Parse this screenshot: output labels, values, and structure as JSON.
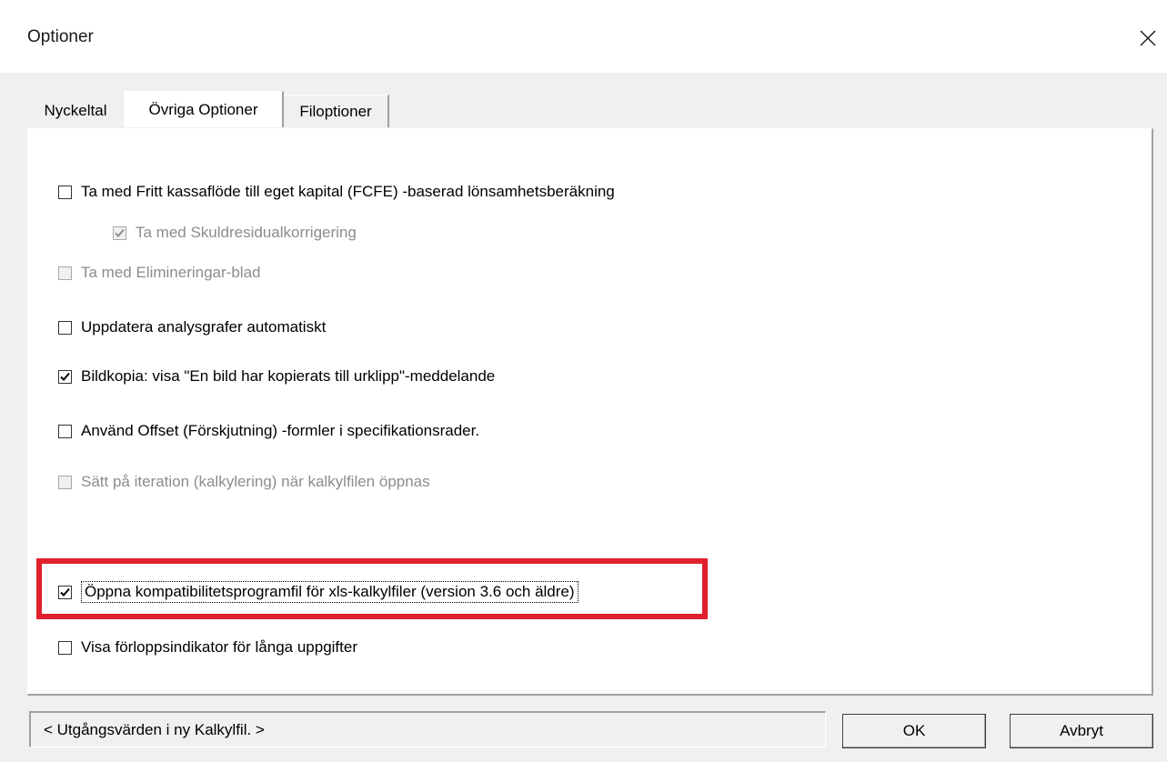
{
  "window": {
    "title": "Optioner",
    "close_icon": "close-icon"
  },
  "tabs": [
    {
      "label": "Nyckeltal",
      "active": false
    },
    {
      "label": "Övriga Optioner",
      "active": true
    },
    {
      "label": "Filoptioner",
      "active": false
    }
  ],
  "options": [
    {
      "label": "Ta med Fritt kassaflöde till eget kapital (FCFE) -baserad lönsamhetsberäkning",
      "checked": false,
      "enabled": true
    },
    {
      "label": "Ta med Skuldresidualkorrigering",
      "checked": true,
      "enabled": false
    },
    {
      "label": "Ta med Elimineringar-blad",
      "checked": false,
      "enabled": false
    },
    {
      "label": "Uppdatera analysgrafer automatiskt",
      "checked": false,
      "enabled": true
    },
    {
      "label": "Bildkopia: visa \"En bild har kopierats till urklipp\"-meddelande",
      "checked": true,
      "enabled": true
    },
    {
      "label": "Använd Offset (Förskjutning) -formler i specifikationsrader.",
      "checked": false,
      "enabled": true
    },
    {
      "label": "Sätt på iteration (kalkylering) när kalkylfilen öppnas",
      "checked": false,
      "enabled": false
    },
    {
      "label": "Öppna kompatibilitetsprogramfil för xls-kalkylfiler (version 3.6 och äldre)",
      "checked": true,
      "enabled": true,
      "highlighted": true
    },
    {
      "label": "Visa förloppsindikator för långa uppgifter",
      "checked": false,
      "enabled": true
    }
  ],
  "footer": {
    "defaults_button": "< Utgångsvärden i ny Kalkylfil. >",
    "ok_label": "OK",
    "cancel_label": "Avbryt"
  },
  "colors": {
    "highlight": "#e0202d",
    "disabled_text": "#8c8c8c"
  }
}
